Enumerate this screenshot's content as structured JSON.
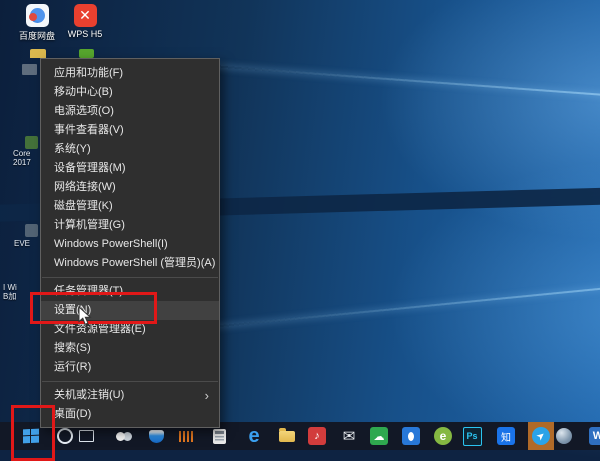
{
  "desktop": {
    "icons": [
      {
        "label": "百度网盘"
      },
      {
        "label": "WPS H5",
        "glyph": "✕"
      }
    ],
    "fragments": {
      "core_line1": "Core",
      "core_line2": "2017",
      "eve": "EVE",
      "wi_line1": "I Wi",
      "wi_line2": "B加"
    }
  },
  "context_menu": {
    "items": [
      {
        "label": "应用和功能(F)"
      },
      {
        "label": "移动中心(B)"
      },
      {
        "label": "电源选项(O)"
      },
      {
        "label": "事件查看器(V)"
      },
      {
        "label": "系统(Y)"
      },
      {
        "label": "设备管理器(M)"
      },
      {
        "label": "网络连接(W)"
      },
      {
        "label": "磁盘管理(K)"
      },
      {
        "label": "计算机管理(G)"
      },
      {
        "label": "Windows PowerShell(I)"
      },
      {
        "label": "Windows PowerShell (管理员)(A)"
      },
      {
        "label": "任务管理器(T)"
      },
      {
        "label": "设置(N)"
      },
      {
        "label": "文件资源管理器(E)"
      },
      {
        "label": "搜索(S)"
      },
      {
        "label": "运行(R)"
      },
      {
        "label": "关机或注销(U)"
      },
      {
        "label": "桌面(D)"
      }
    ],
    "submenu_arrow": "›"
  },
  "taskbar": {
    "edge_label": "e",
    "green_e_label": "e",
    "ps_label": "Ps",
    "zhihu_label": "知",
    "partial_label": "W",
    "music_note": "♪",
    "mail_glyph": "✉",
    "cloud_glyph": "☁",
    "plane_glyph": "➤"
  },
  "annotations": {
    "highlight_color": "#e11818",
    "highlighted_menu_item": "设置(N)",
    "highlighted_taskbar_item": "start-button"
  }
}
